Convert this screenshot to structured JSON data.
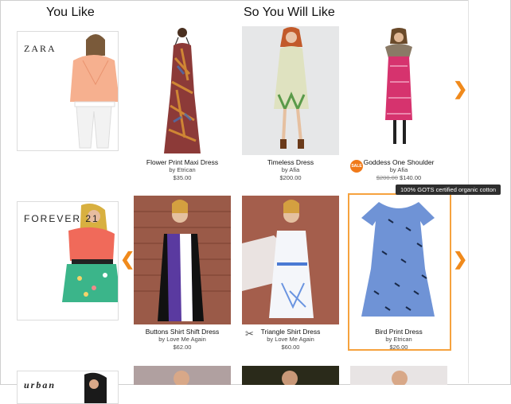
{
  "headings": {
    "you_like": "You Like",
    "so_you_will_like": "So You Will Like"
  },
  "rows": [
    {
      "liked": {
        "logo": "ZARA"
      },
      "products": [
        {
          "name": "Flower Print Maxi Dress",
          "brand": "by Etrican",
          "price": "$35.00"
        },
        {
          "name": "Timeless Dress",
          "brand": "by Afia",
          "price": "$200.00"
        },
        {
          "name": "Goddess One Shoulder",
          "brand": "by Afia",
          "old_price": "$200.00",
          "price": "$140.00",
          "badge": "SALE"
        }
      ]
    },
    {
      "liked": {
        "logo": "FOREVER 21"
      },
      "products": [
        {
          "name": "Buttons Shirt Shift Dress",
          "brand": "by Love Me Again",
          "price": "$62.00"
        },
        {
          "name": "Triangle Shirt Dress",
          "brand": "by Love Me Again",
          "price": "$60.00"
        },
        {
          "name": "Bird Print Dress",
          "brand": "by Etrican",
          "price": "$26.00"
        }
      ]
    },
    {
      "liked": {
        "logo": "urban"
      }
    }
  ],
  "tooltip": "100% GOTS certified organic cotton",
  "arrows": {
    "next": "❯",
    "prev": "❮"
  },
  "icons": {
    "scissors": "✂"
  },
  "colors": {
    "accent": "#f08a1c",
    "highlight": "#f6a23e",
    "tooltip_bg": "#2e2e2e"
  }
}
